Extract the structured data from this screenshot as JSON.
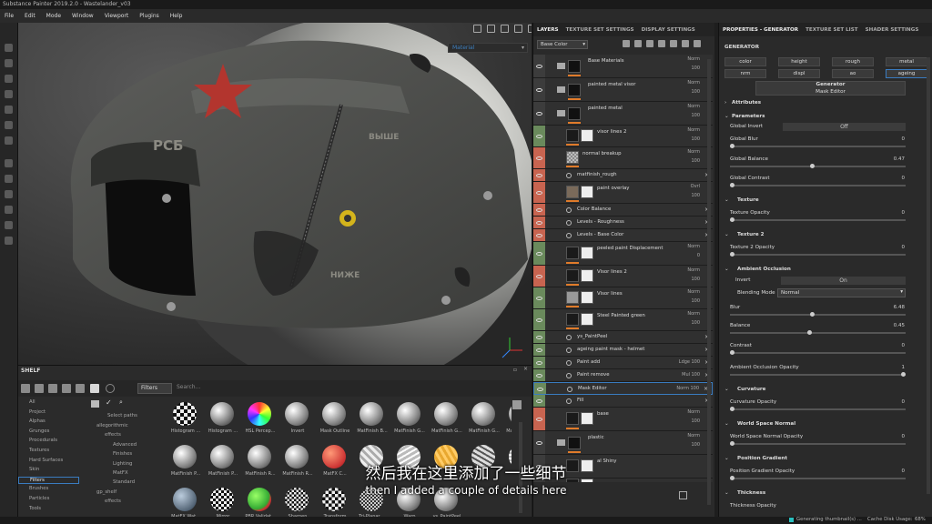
{
  "window": {
    "title": "Substance Painter 2019.2.0 - Wastelander_v03"
  },
  "menu": [
    "File",
    "Edit",
    "Mode",
    "Window",
    "Viewport",
    "Plugins",
    "Help"
  ],
  "viewport": {
    "render_mode": "Material",
    "helmet_text_left": "РСБ",
    "helmet_text_top": "ВЫШЕ",
    "helmet_text_bottom": "НИЖЕ"
  },
  "shelf": {
    "title": "SHELF",
    "filter_label": "Filters",
    "search_placeholder": "Search...",
    "categories": [
      "All",
      "Project",
      "Alphas",
      "Grunges",
      "Procedurals",
      "Textures",
      "Hard Surfaces",
      "Skin",
      "Filters",
      "Brushes",
      "Particles",
      "Tools"
    ],
    "selected_category": "Filters",
    "tree": {
      "header": "Select paths",
      "items": [
        {
          "label": "allegorithmic",
          "indent": 0
        },
        {
          "label": "effects",
          "indent": 1
        },
        {
          "label": "Advanced",
          "indent": 2
        },
        {
          "label": "Finishes",
          "indent": 2
        },
        {
          "label": "Lighting",
          "indent": 2
        },
        {
          "label": "MatFX",
          "indent": 2
        },
        {
          "label": "Standard",
          "indent": 2
        },
        {
          "label": "gp_shelf",
          "indent": 0
        },
        {
          "label": "effects",
          "indent": 1
        }
      ]
    },
    "assets_row1": [
      "Histogram ...",
      "Histogram ...",
      "HSL Percep...",
      "Invert",
      "Mask Outline",
      "MatFinish B...",
      "MatFinish G...",
      "MatFinish G...",
      "MatFinish G...",
      "MatFinish H..."
    ],
    "assets_row2": [
      "MatFinish P...",
      "MatFinish P...",
      "MatFinish R...",
      "MatFinish R...",
      "MatFX C...",
      "",
      "",
      "",
      "",
      ""
    ],
    "assets_row3": [
      "MatFX Wat...",
      "Mirror",
      "PBR Validat...",
      "Sharpen",
      "Transform",
      "Tri-Planar ...",
      "Warp",
      "ys_PaintPeel"
    ]
  },
  "layers": {
    "tabs": [
      {
        "label": "LAYERS",
        "active": true
      },
      {
        "label": "TEXTURE SET SETTINGS",
        "active": false
      },
      {
        "label": "DISPLAY SETTINGS",
        "active": false
      }
    ],
    "channel": "Base Color",
    "rows": [
      {
        "name": "Base Materials",
        "blend": "Norm",
        "opacity": "100",
        "type": "folder"
      },
      {
        "name": "painted metal visor",
        "blend": "Norm",
        "opacity": "100",
        "type": "folder"
      },
      {
        "name": "painted metal",
        "blend": "Norm",
        "opacity": "100",
        "type": "folder"
      },
      {
        "name": "visor lines 2",
        "blend": "Norm",
        "opacity": "100",
        "type": "layer"
      },
      {
        "name": "normal breakup",
        "blend": "Norm",
        "opacity": "100",
        "type": "layer"
      },
      {
        "name": "matfinish_rough",
        "blend": "",
        "opacity": "",
        "type": "effect"
      },
      {
        "name": "paint overlay",
        "blend": "Ovrl",
        "opacity": "100",
        "type": "layer"
      },
      {
        "name": "Color Balance",
        "blend": "",
        "opacity": "",
        "type": "effect"
      },
      {
        "name": "Levels - Roughness",
        "blend": "",
        "opacity": "",
        "type": "effect"
      },
      {
        "name": "Levels - Base Color",
        "blend": "",
        "opacity": "",
        "type": "effect"
      },
      {
        "name": "peeled paint Displacement",
        "blend": "Norm",
        "opacity": "0",
        "type": "layer"
      },
      {
        "name": "Visor lines 2",
        "blend": "Norm",
        "opacity": "100",
        "type": "layer"
      },
      {
        "name": "Visor lines",
        "blend": "Norm",
        "opacity": "100",
        "type": "layer"
      },
      {
        "name": "Steel Painted green",
        "blend": "Norm",
        "opacity": "100",
        "type": "layer"
      },
      {
        "name": "ys_PaintPeel",
        "blend": "",
        "opacity": "",
        "type": "effect"
      },
      {
        "name": "ageing paint mask - helmet",
        "blend": "",
        "opacity": "",
        "type": "effect"
      },
      {
        "name": "Paint add",
        "blend": "Ldge",
        "opacity": "100",
        "type": "effect"
      },
      {
        "name": "Paint remove",
        "blend": "Mul",
        "opacity": "100",
        "type": "effect"
      },
      {
        "name": "Mask Editor",
        "blend": "Norm",
        "opacity": "100",
        "type": "effect"
      },
      {
        "name": "Fill",
        "blend": "",
        "opacity": "",
        "type": "effect"
      },
      {
        "name": "base",
        "blend": "Norm",
        "opacity": "100",
        "type": "layer"
      },
      {
        "name": "plastic",
        "blend": "Norm",
        "opacity": "100",
        "type": "folder"
      },
      {
        "name": "al Shiny",
        "blend": "",
        "opacity": "",
        "type": "layer"
      },
      {
        "name": "ance",
        "blend": "",
        "opacity": "",
        "type": "layer"
      }
    ]
  },
  "properties": {
    "tabs": [
      {
        "label": "PROPERTIES - GENERATOR",
        "active": true
      },
      {
        "label": "TEXTURE SET LIST",
        "active": false
      },
      {
        "label": "SHADER SETTINGS",
        "active": false
      }
    ],
    "section_title": "GENERATOR",
    "channels": [
      "color",
      "height",
      "rough",
      "metal",
      "nrm",
      "displ",
      "ao",
      "ageing"
    ],
    "generator_label": "Generator",
    "generator_value": "Mask Editor",
    "attributes": "Attributes",
    "parameters": "Parameters",
    "global_invert_label": "Global Invert",
    "global_invert_value": "Off",
    "global_blur": {
      "label": "Global Blur",
      "value": "0",
      "fraction": 0
    },
    "global_balance": {
      "label": "Global Balance",
      "value": "0.47",
      "fraction": 0.47
    },
    "global_contrast": {
      "label": "Global Contrast",
      "value": "0",
      "fraction": 0
    },
    "texture": "Texture",
    "texture_opacity": {
      "label": "Texture Opacity",
      "value": "0",
      "fraction": 0
    },
    "texture2": "Texture 2",
    "texture2_opacity": {
      "label": "Texture 2 Opacity",
      "value": "0",
      "fraction": 0
    },
    "ao": "Ambient Occlusion",
    "ao_invert_label": "Invert",
    "ao_invert_value": "On",
    "ao_blend_label": "Blending Mode",
    "ao_blend_value": "Normal",
    "ao_blur": {
      "label": "Blur",
      "value": "6.48",
      "fraction": 0.47
    },
    "ao_balance": {
      "label": "Balance",
      "value": "0.45",
      "fraction": 0.45
    },
    "ao_contrast": {
      "label": "Contrast",
      "value": "0",
      "fraction": 0
    },
    "ao_opacity": {
      "label": "Ambient Occlusion Opacity",
      "value": "1",
      "fraction": 1
    },
    "curvature": "Curvature",
    "curvature_opacity": {
      "label": "Curvature Opacity",
      "value": "0",
      "fraction": 0
    },
    "wsn": "World Space Normal",
    "wsn_opacity": {
      "label": "World Space Normal Opacity",
      "value": "0",
      "fraction": 0
    },
    "pg": "Position Gradient",
    "pg_opacity": {
      "label": "Position Gradient Opacity",
      "value": "0",
      "fraction": 0
    },
    "thickness": "Thickness",
    "thickness_opacity": {
      "label": "Thickness Opacity",
      "value": ""
    }
  },
  "status": {
    "message": "Generating thumbnail(s) ...",
    "cache": "Cache Disk Usage:",
    "cache_value": "68%"
  },
  "subtitles": {
    "cn": "然后我在这里添加了一些细节",
    "en": "then I added a couple of details here"
  }
}
